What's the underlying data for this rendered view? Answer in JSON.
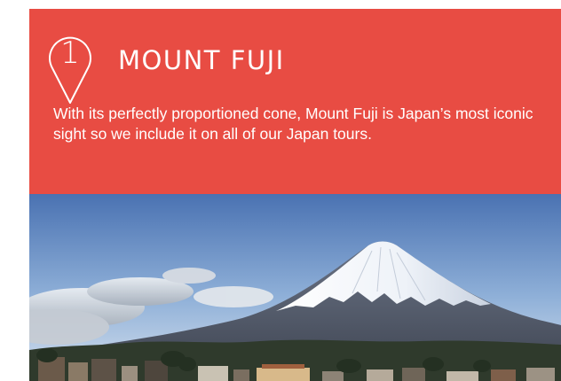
{
  "colors": {
    "brand_red": "#e84c43",
    "white": "#ffffff",
    "sky_top": "#4f78b6",
    "sky_bottom": "#c9d8ea",
    "mountain": "#5e6777",
    "snow": "#f4f6fa"
  },
  "marker": {
    "icon": "location-pin-icon",
    "number": "1"
  },
  "attraction": {
    "title": "MOUNT FUJI",
    "description": "With its perfectly proportioned cone, Mount Fuji is Japan’s most iconic sight so we include it on all of our Japan tours."
  },
  "photo": {
    "subject": "mount-fuji-photo"
  }
}
